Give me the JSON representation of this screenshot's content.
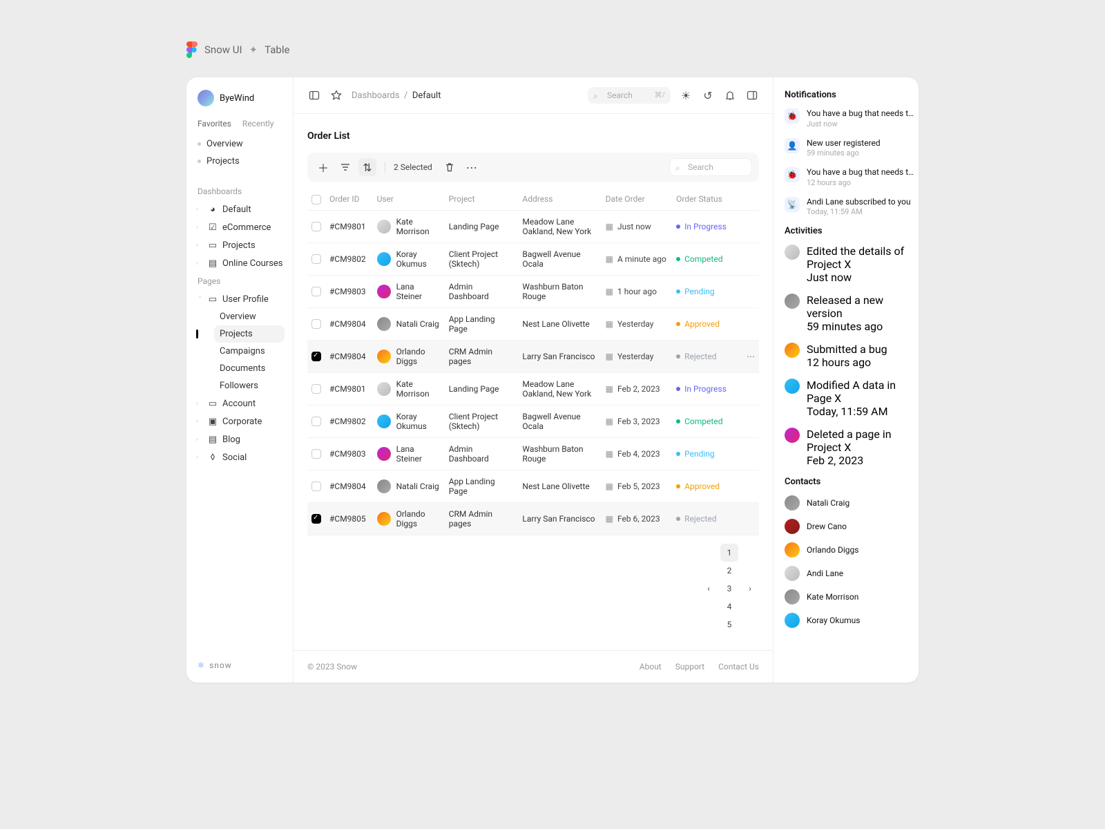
{
  "pageTitle": {
    "a": "Snow UI",
    "b": "Table"
  },
  "sidebar": {
    "userName": "ByeWind",
    "tabs": [
      "Favorites",
      "Recently"
    ],
    "favorites": [
      "Overview",
      "Projects"
    ],
    "dashboardsLabel": "Dashboards",
    "dashboards": [
      {
        "label": "Default"
      },
      {
        "label": "eCommerce"
      },
      {
        "label": "Projects"
      },
      {
        "label": "Online Courses"
      }
    ],
    "pagesLabel": "Pages",
    "userProfile": {
      "label": "User Profile",
      "children": [
        "Overview",
        "Projects",
        "Campaigns",
        "Documents",
        "Followers"
      ],
      "active": "Projects"
    },
    "pages": [
      {
        "label": "Account"
      },
      {
        "label": "Corporate"
      },
      {
        "label": "Blog"
      },
      {
        "label": "Social"
      }
    ],
    "brand": "snow"
  },
  "topbar": {
    "crumbA": "Dashboards",
    "crumbB": "Default",
    "searchPlaceholder": "Search",
    "searchKbd": "⌘/"
  },
  "content": {
    "title": "Order List",
    "selectedText": "2 Selected",
    "searchPlaceholder": "Search",
    "columns": [
      "Order ID",
      "User",
      "Project",
      "Address",
      "Date Order",
      "Order Status"
    ],
    "rows": [
      {
        "checked": false,
        "id": "#CM9801",
        "user": "Kate Morrison",
        "av": "av1",
        "project": "Landing Page",
        "address": "Meadow Lane Oakland, New York",
        "date": "Just now",
        "status": "In Progress",
        "scls": "s-progress"
      },
      {
        "checked": false,
        "id": "#CM9802",
        "user": "Koray Okumus",
        "av": "av6",
        "project": "Client Project (Sktech)",
        "address": "Bagwell Avenue Ocala",
        "date": "A minute ago",
        "status": "Competed",
        "scls": "s-competed"
      },
      {
        "checked": false,
        "id": "#CM9803",
        "user": "Lana Steiner",
        "av": "av2",
        "project": "Admin Dashboard",
        "address": "Washburn Baton Rouge",
        "date": "1 hour ago",
        "status": "Pending",
        "scls": "s-pending"
      },
      {
        "checked": false,
        "id": "#CM9804",
        "user": "Natali Craig",
        "av": "av4",
        "project": "App Landing Page",
        "address": "Nest Lane Olivette",
        "date": "Yesterday",
        "status": "Approved",
        "scls": "s-approved"
      },
      {
        "checked": true,
        "id": "#CM9804",
        "user": "Orlando Diggs",
        "av": "av3",
        "project": "CRM Admin pages",
        "address": "Larry San Francisco",
        "date": "Yesterday",
        "status": "Rejected",
        "scls": "s-rejected",
        "more": true
      },
      {
        "checked": false,
        "id": "#CM9801",
        "user": "Kate Morrison",
        "av": "av1",
        "project": "Landing Page",
        "address": "Meadow Lane Oakland, New York",
        "date": "Feb 2, 2023",
        "status": "In Progress",
        "scls": "s-progress"
      },
      {
        "checked": false,
        "id": "#CM9802",
        "user": "Koray Okumus",
        "av": "av6",
        "project": "Client Project (Sktech)",
        "address": "Bagwell Avenue Ocala",
        "date": "Feb 3, 2023",
        "status": "Competed",
        "scls": "s-competed"
      },
      {
        "checked": false,
        "id": "#CM9803",
        "user": "Lana Steiner",
        "av": "av2",
        "project": "Admin Dashboard",
        "address": "Washburn Baton Rouge",
        "date": "Feb 4, 2023",
        "status": "Pending",
        "scls": "s-pending"
      },
      {
        "checked": false,
        "id": "#CM9804",
        "user": "Natali Craig",
        "av": "av4",
        "project": "App Landing Page",
        "address": "Nest Lane Olivette",
        "date": "Feb 5, 2023",
        "status": "Approved",
        "scls": "s-approved"
      },
      {
        "checked": true,
        "id": "#CM9805",
        "user": "Orlando Diggs",
        "av": "av3",
        "project": "CRM Admin pages",
        "address": "Larry San Francisco",
        "date": "Feb 6, 2023",
        "status": "Rejected",
        "scls": "s-rejected"
      }
    ],
    "pages": [
      "1",
      "2",
      "3",
      "4",
      "5"
    ]
  },
  "footer": {
    "copyright": "© 2023 Snow",
    "links": [
      "About",
      "Support",
      "Contact Us"
    ]
  },
  "rightbar": {
    "notifLabel": "Notifications",
    "notifications": [
      {
        "icon": "🐞",
        "text": "You have a bug that needs t…",
        "time": "Just now"
      },
      {
        "icon": "👤",
        "text": "New user registered",
        "time": "59 minutes ago"
      },
      {
        "icon": "🐞",
        "text": "You have a bug that needs t…",
        "time": "12 hours ago"
      },
      {
        "icon": "📡",
        "text": "Andi Lane subscribed to you",
        "time": "Today, 11:59 AM"
      }
    ],
    "actLabel": "Activities",
    "activities": [
      {
        "av": "av1",
        "text": "Edited the details of Project X",
        "time": "Just now"
      },
      {
        "av": "av4",
        "text": "Released a new version",
        "time": "59 minutes ago"
      },
      {
        "av": "av3",
        "text": "Submitted a bug",
        "time": "12 hours ago"
      },
      {
        "av": "av6",
        "text": "Modified A data in Page X",
        "time": "Today, 11:59 AM"
      },
      {
        "av": "av2",
        "text": "Deleted a page in Project X",
        "time": "Feb 2, 2023"
      }
    ],
    "contactsLabel": "Contacts",
    "contacts": [
      {
        "av": "av4",
        "name": "Natali Craig"
      },
      {
        "av": "av5",
        "name": "Drew Cano"
      },
      {
        "av": "av3",
        "name": "Orlando Diggs"
      },
      {
        "av": "av1",
        "name": "Andi Lane"
      },
      {
        "av": "av4",
        "name": "Kate Morrison"
      },
      {
        "av": "av6",
        "name": "Koray Okumus"
      }
    ]
  }
}
